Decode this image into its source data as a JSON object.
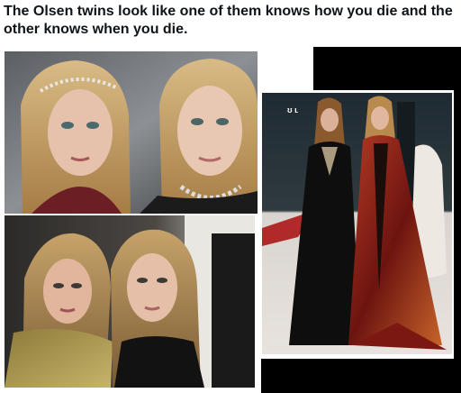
{
  "post": {
    "text": "The Olsen twins look like one of them knows how you die and the other knows when you die."
  },
  "media": {
    "photos": [
      {
        "name": "closeup-portrait"
      },
      {
        "name": "lower-portrait"
      },
      {
        "name": "full-length-portrait"
      }
    ]
  },
  "colors": {
    "text": "#0f1419",
    "background": "#ffffff",
    "black": "#000000",
    "hair_blonde": "#c9a46b",
    "skin": "#e8c4ae",
    "gown_red": "#8a1c1e",
    "gown_black": "#111111"
  }
}
